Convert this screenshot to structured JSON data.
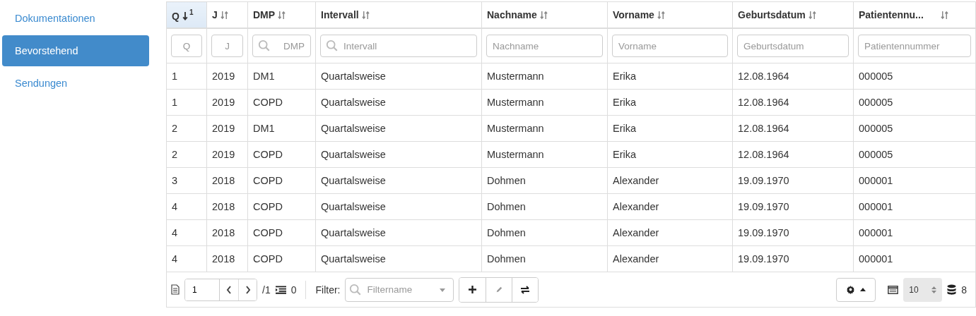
{
  "sidebar": {
    "items": [
      {
        "label": "Dokumentationen",
        "selected": false
      },
      {
        "label": "Bevorstehend",
        "selected": true
      },
      {
        "label": "Sendungen",
        "selected": false
      }
    ]
  },
  "table": {
    "columns": [
      {
        "label": "Q",
        "sorted": true,
        "sort_rank": "1",
        "filter_placeholder": "Q",
        "search_icon": false
      },
      {
        "label": "J",
        "sorted": false,
        "filter_placeholder": "J",
        "search_icon": false
      },
      {
        "label": "DMP",
        "sorted": false,
        "filter_placeholder": "DMP",
        "search_icon": true
      },
      {
        "label": "Intervall",
        "sorted": false,
        "filter_placeholder": "Intervall",
        "search_icon": true
      },
      {
        "label": "Nachname",
        "sorted": false,
        "filter_placeholder": "Nachname",
        "search_icon": false
      },
      {
        "label": "Vorname",
        "sorted": false,
        "filter_placeholder": "Vorname",
        "search_icon": false
      },
      {
        "label": "Geburtsdatum",
        "sorted": false,
        "filter_placeholder": "Geburtsdatum",
        "search_icon": false
      },
      {
        "label": "Patientennu...",
        "sorted": false,
        "filter_placeholder": "Patientennummer",
        "search_icon": false
      }
    ],
    "rows": [
      [
        "1",
        "2019",
        "DM1",
        "Quartalsweise",
        "Mustermann",
        "Erika",
        "12.08.1964",
        "000005"
      ],
      [
        "1",
        "2019",
        "COPD",
        "Quartalsweise",
        "Mustermann",
        "Erika",
        "12.08.1964",
        "000005"
      ],
      [
        "2",
        "2019",
        "DM1",
        "Quartalsweise",
        "Mustermann",
        "Erika",
        "12.08.1964",
        "000005"
      ],
      [
        "2",
        "2019",
        "COPD",
        "Quartalsweise",
        "Mustermann",
        "Erika",
        "12.08.1964",
        "000005"
      ],
      [
        "3",
        "2018",
        "COPD",
        "Quartalsweise",
        "Dohmen",
        "Alexander",
        "19.09.1970",
        "000001"
      ],
      [
        "4",
        "2018",
        "COPD",
        "Quartalsweise",
        "Dohmen",
        "Alexander",
        "19.09.1970",
        "000001"
      ],
      [
        "4",
        "2018",
        "COPD",
        "Quartalsweise",
        "Dohmen",
        "Alexander",
        "19.09.1970",
        "000001"
      ],
      [
        "4",
        "2018",
        "COPD",
        "Quartalsweise",
        "Dohmen",
        "Alexander",
        "19.09.1970",
        "000001"
      ]
    ]
  },
  "footer": {
    "page": "1",
    "page_total": "/1",
    "selected_count": "0",
    "filter_label": "Filter:",
    "filter_placeholder": "Filtername",
    "page_size": "10",
    "record_count": "8"
  }
}
